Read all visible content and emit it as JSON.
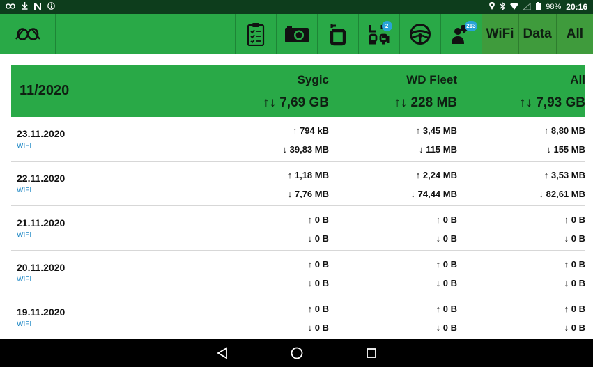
{
  "status_bar": {
    "left_icons": [
      "pretzel-logo-icon",
      "download-icon",
      "n-icon",
      "info-icon"
    ],
    "right_icons": [
      "location-icon",
      "bluetooth-icon",
      "wifi-icon",
      "signal-icon",
      "battery-icon"
    ],
    "battery": "98%",
    "time": "20:16"
  },
  "toolbar": {
    "buttons": [
      {
        "icon": "checklist-icon"
      },
      {
        "icon": "camera-icon"
      },
      {
        "icon": "route-icon"
      },
      {
        "icon": "apps-icon",
        "badge": "2"
      },
      {
        "icon": "steering-wheel-icon"
      },
      {
        "icon": "messages-icon",
        "badge": "213"
      }
    ],
    "toggles": [
      "WiFi",
      "Data",
      "All"
    ]
  },
  "table": {
    "period": "11/2020",
    "columns": [
      {
        "name": "Sygic",
        "total": "↑↓ 7,69 GB"
      },
      {
        "name": "WD Fleet",
        "total": "↑↓ 228 MB"
      },
      {
        "name": "All",
        "total": "↑↓ 7,93 GB"
      }
    ],
    "rows": [
      {
        "date": "23.11.2020",
        "mode": "WIFI",
        "cells": [
          [
            "↑ 794 kB",
            "↓ 39,83 MB"
          ],
          [
            "↑ 3,45 MB",
            "↓ 115 MB"
          ],
          [
            "↑ 8,80 MB",
            "↓ 155 MB"
          ]
        ]
      },
      {
        "date": "22.11.2020",
        "mode": "WIFI",
        "cells": [
          [
            "↑ 1,18 MB",
            "↓ 7,76 MB"
          ],
          [
            "↑ 2,24 MB",
            "↓ 74,44 MB"
          ],
          [
            "↑ 3,53 MB",
            "↓ 82,61 MB"
          ]
        ]
      },
      {
        "date": "21.11.2020",
        "mode": "WIFI",
        "cells": [
          [
            "↑ 0 B",
            "↓ 0 B"
          ],
          [
            "↑ 0 B",
            "↓ 0 B"
          ],
          [
            "↑ 0 B",
            "↓ 0 B"
          ]
        ]
      },
      {
        "date": "20.11.2020",
        "mode": "WIFI",
        "cells": [
          [
            "↑ 0 B",
            "↓ 0 B"
          ],
          [
            "↑ 0 B",
            "↓ 0 B"
          ],
          [
            "↑ 0 B",
            "↓ 0 B"
          ]
        ]
      },
      {
        "date": "19.11.2020",
        "mode": "WIFI",
        "cells": [
          [
            "↑ 0 B",
            "↓ 0 B"
          ],
          [
            "↑ 0 B",
            "↓ 0 B"
          ],
          [
            "↑ 0 B",
            "↓ 0 B"
          ]
        ]
      }
    ]
  },
  "nav_bar": {
    "icons": [
      "back-icon",
      "home-icon",
      "recents-icon"
    ]
  },
  "colors": {
    "toolbar": "#29a947",
    "status_bar": "#0d3d1c",
    "badge": "#29a3d8",
    "mode_text": "#1b86c4"
  }
}
